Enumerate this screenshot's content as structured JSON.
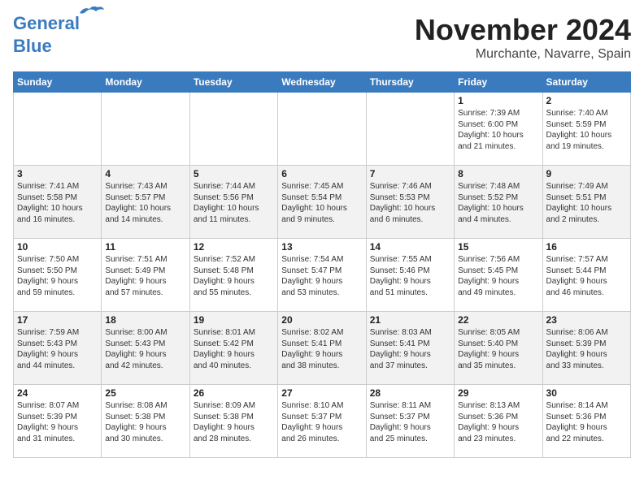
{
  "header": {
    "logo_line1": "General",
    "logo_line2": "Blue",
    "month": "November 2024",
    "location": "Murchante, Navarre, Spain"
  },
  "days_of_week": [
    "Sunday",
    "Monday",
    "Tuesday",
    "Wednesday",
    "Thursday",
    "Friday",
    "Saturday"
  ],
  "weeks": [
    [
      {
        "day": "",
        "info": ""
      },
      {
        "day": "",
        "info": ""
      },
      {
        "day": "",
        "info": ""
      },
      {
        "day": "",
        "info": ""
      },
      {
        "day": "",
        "info": ""
      },
      {
        "day": "1",
        "info": "Sunrise: 7:39 AM\nSunset: 6:00 PM\nDaylight: 10 hours\nand 21 minutes."
      },
      {
        "day": "2",
        "info": "Sunrise: 7:40 AM\nSunset: 5:59 PM\nDaylight: 10 hours\nand 19 minutes."
      }
    ],
    [
      {
        "day": "3",
        "info": "Sunrise: 7:41 AM\nSunset: 5:58 PM\nDaylight: 10 hours\nand 16 minutes."
      },
      {
        "day": "4",
        "info": "Sunrise: 7:43 AM\nSunset: 5:57 PM\nDaylight: 10 hours\nand 14 minutes."
      },
      {
        "day": "5",
        "info": "Sunrise: 7:44 AM\nSunset: 5:56 PM\nDaylight: 10 hours\nand 11 minutes."
      },
      {
        "day": "6",
        "info": "Sunrise: 7:45 AM\nSunset: 5:54 PM\nDaylight: 10 hours\nand 9 minutes."
      },
      {
        "day": "7",
        "info": "Sunrise: 7:46 AM\nSunset: 5:53 PM\nDaylight: 10 hours\nand 6 minutes."
      },
      {
        "day": "8",
        "info": "Sunrise: 7:48 AM\nSunset: 5:52 PM\nDaylight: 10 hours\nand 4 minutes."
      },
      {
        "day": "9",
        "info": "Sunrise: 7:49 AM\nSunset: 5:51 PM\nDaylight: 10 hours\nand 2 minutes."
      }
    ],
    [
      {
        "day": "10",
        "info": "Sunrise: 7:50 AM\nSunset: 5:50 PM\nDaylight: 9 hours\nand 59 minutes."
      },
      {
        "day": "11",
        "info": "Sunrise: 7:51 AM\nSunset: 5:49 PM\nDaylight: 9 hours\nand 57 minutes."
      },
      {
        "day": "12",
        "info": "Sunrise: 7:52 AM\nSunset: 5:48 PM\nDaylight: 9 hours\nand 55 minutes."
      },
      {
        "day": "13",
        "info": "Sunrise: 7:54 AM\nSunset: 5:47 PM\nDaylight: 9 hours\nand 53 minutes."
      },
      {
        "day": "14",
        "info": "Sunrise: 7:55 AM\nSunset: 5:46 PM\nDaylight: 9 hours\nand 51 minutes."
      },
      {
        "day": "15",
        "info": "Sunrise: 7:56 AM\nSunset: 5:45 PM\nDaylight: 9 hours\nand 49 minutes."
      },
      {
        "day": "16",
        "info": "Sunrise: 7:57 AM\nSunset: 5:44 PM\nDaylight: 9 hours\nand 46 minutes."
      }
    ],
    [
      {
        "day": "17",
        "info": "Sunrise: 7:59 AM\nSunset: 5:43 PM\nDaylight: 9 hours\nand 44 minutes."
      },
      {
        "day": "18",
        "info": "Sunrise: 8:00 AM\nSunset: 5:43 PM\nDaylight: 9 hours\nand 42 minutes."
      },
      {
        "day": "19",
        "info": "Sunrise: 8:01 AM\nSunset: 5:42 PM\nDaylight: 9 hours\nand 40 minutes."
      },
      {
        "day": "20",
        "info": "Sunrise: 8:02 AM\nSunset: 5:41 PM\nDaylight: 9 hours\nand 38 minutes."
      },
      {
        "day": "21",
        "info": "Sunrise: 8:03 AM\nSunset: 5:41 PM\nDaylight: 9 hours\nand 37 minutes."
      },
      {
        "day": "22",
        "info": "Sunrise: 8:05 AM\nSunset: 5:40 PM\nDaylight: 9 hours\nand 35 minutes."
      },
      {
        "day": "23",
        "info": "Sunrise: 8:06 AM\nSunset: 5:39 PM\nDaylight: 9 hours\nand 33 minutes."
      }
    ],
    [
      {
        "day": "24",
        "info": "Sunrise: 8:07 AM\nSunset: 5:39 PM\nDaylight: 9 hours\nand 31 minutes."
      },
      {
        "day": "25",
        "info": "Sunrise: 8:08 AM\nSunset: 5:38 PM\nDaylight: 9 hours\nand 30 minutes."
      },
      {
        "day": "26",
        "info": "Sunrise: 8:09 AM\nSunset: 5:38 PM\nDaylight: 9 hours\nand 28 minutes."
      },
      {
        "day": "27",
        "info": "Sunrise: 8:10 AM\nSunset: 5:37 PM\nDaylight: 9 hours\nand 26 minutes."
      },
      {
        "day": "28",
        "info": "Sunrise: 8:11 AM\nSunset: 5:37 PM\nDaylight: 9 hours\nand 25 minutes."
      },
      {
        "day": "29",
        "info": "Sunrise: 8:13 AM\nSunset: 5:36 PM\nDaylight: 9 hours\nand 23 minutes."
      },
      {
        "day": "30",
        "info": "Sunrise: 8:14 AM\nSunset: 5:36 PM\nDaylight: 9 hours\nand 22 minutes."
      }
    ]
  ]
}
